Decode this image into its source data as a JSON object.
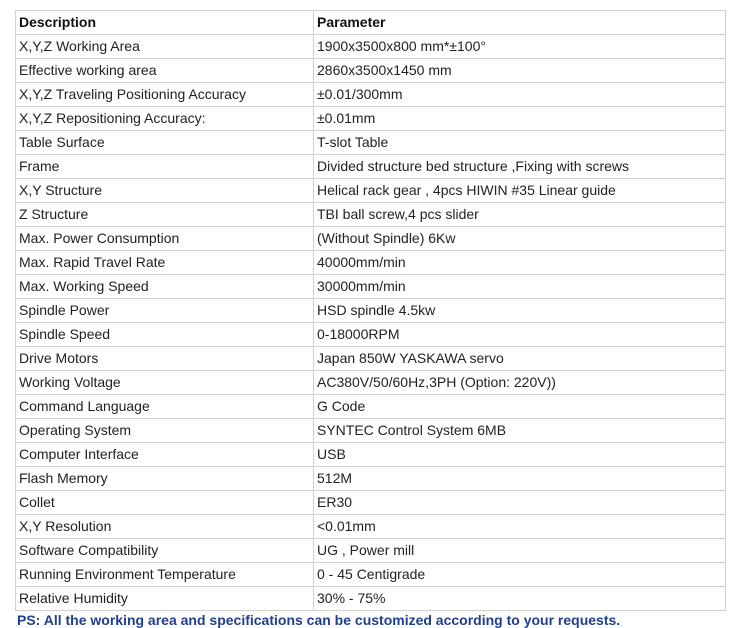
{
  "table": {
    "headers": [
      "Description",
      "Parameter"
    ],
    "rows": [
      [
        "X,Y,Z Working Area",
        "1900x3500x800 mm*±100°"
      ],
      [
        "Effective working area",
        "2860x3500x1450 mm"
      ],
      [
        "X,Y,Z Traveling Positioning Accuracy",
        "±0.01/300mm"
      ],
      [
        "X,Y,Z Repositioning Accuracy:",
        "±0.01mm"
      ],
      [
        "Table Surface",
        "T-slot Table"
      ],
      [
        "Frame",
        "Divided structure bed structure ,Fixing with screws"
      ],
      [
        "X,Y Structure",
        "Helical rack gear , 4pcs HIWIN #35 Linear guide"
      ],
      [
        "Z Structure",
        "TBI ball screw,4 pcs slider"
      ],
      [
        "Max. Power Consumption",
        "(Without Spindle) 6Kw"
      ],
      [
        "Max. Rapid Travel Rate",
        "40000mm/min"
      ],
      [
        "Max. Working Speed",
        "30000mm/min"
      ],
      [
        "Spindle Power",
        "HSD spindle 4.5kw"
      ],
      [
        "Spindle Speed",
        "0-18000RPM"
      ],
      [
        "Drive Motors",
        "Japan 850W YASKAWA servo"
      ],
      [
        "Working Voltage",
        "AC380V/50/60Hz,3PH (Option: 220V))"
      ],
      [
        "Command Language",
        "G Code"
      ],
      [
        "Operating System",
        "SYNTEC Control System 6MB"
      ],
      [
        "Computer Interface",
        "USB"
      ],
      [
        "Flash Memory",
        "512M"
      ],
      [
        "Collet",
        "ER30"
      ],
      [
        "X,Y Resolution",
        "<0.01mm"
      ],
      [
        "Software Compatibility",
        "UG , Power mill"
      ],
      [
        "Running Environment  Temperature",
        "0 - 45 Centigrade"
      ],
      [
        "Relative Humidity",
        "30% - 75%"
      ]
    ]
  },
  "note": {
    "text": "PS: All the working area and specifications can be customized according to your requests."
  },
  "colors": {
    "note_text": "#1f3f8f",
    "border": "#d0d0d0"
  }
}
